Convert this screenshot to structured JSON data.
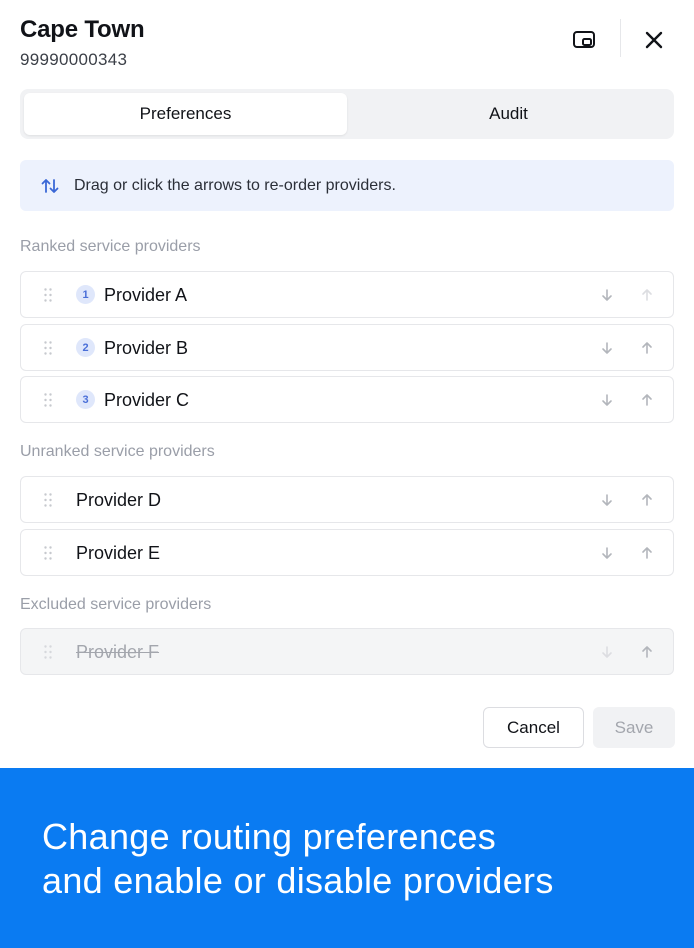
{
  "header": {
    "title": "Cape Town",
    "subtitle": "99990000343"
  },
  "tabs": [
    {
      "label": "Preferences",
      "active": true
    },
    {
      "label": "Audit",
      "active": false
    }
  ],
  "hint": {
    "icon": "sort-arrows-icon",
    "text": "Drag or click the arrows to re-order providers."
  },
  "sections": {
    "ranked": {
      "label": "Ranked service providers",
      "items": [
        {
          "rank": "1",
          "name": "Provider A"
        },
        {
          "rank": "2",
          "name": "Provider B"
        },
        {
          "rank": "3",
          "name": "Provider C"
        }
      ]
    },
    "unranked": {
      "label": "Unranked service providers",
      "items": [
        {
          "name": "Provider D"
        },
        {
          "name": "Provider E"
        }
      ]
    },
    "excluded": {
      "label": "Excluded service providers",
      "items": [
        {
          "name": "Provider F"
        }
      ]
    }
  },
  "footer": {
    "cancel_label": "Cancel",
    "save_label": "Save",
    "save_disabled": true
  },
  "banner": {
    "line1": "Change routing preferences",
    "line2": "and enable or disable providers"
  },
  "colors": {
    "accent": "#0a7bf2",
    "badge_bg": "#dfe7fb",
    "badge_text": "#4a6fd8",
    "hint_bg": "#edf2fd"
  }
}
